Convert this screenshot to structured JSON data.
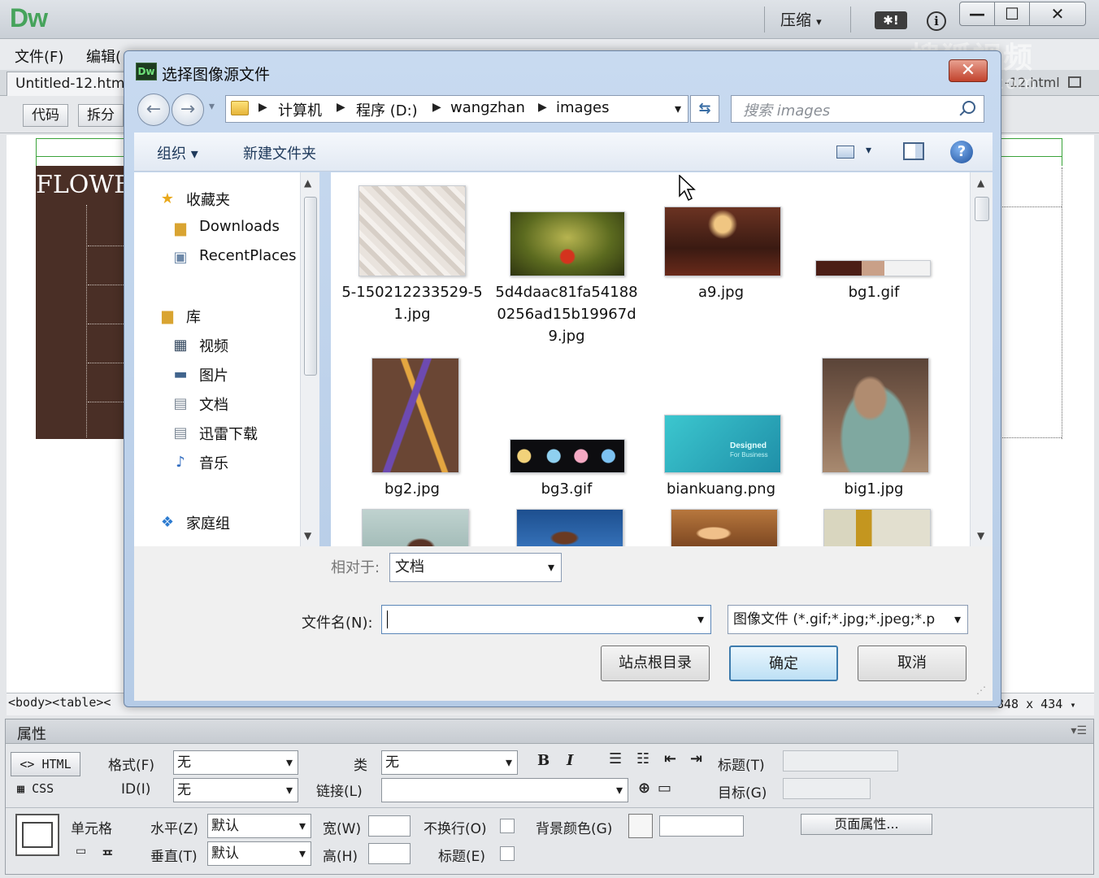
{
  "app": {
    "logo": "Dw",
    "compress_label": "压缩",
    "feedback_badge": "✱!",
    "info_label": "i",
    "min_label": "—",
    "max_label": "☐",
    "close_label": "✕"
  },
  "menu": {
    "file": "文件(F)",
    "edit": "编辑("
  },
  "doc_tabs": {
    "active": "Untitled-12.html",
    "right": "-12.html"
  },
  "doc_toolbar": {
    "code": "代码",
    "split": "拆分"
  },
  "design": {
    "page_text": "FLOWE"
  },
  "status": {
    "tags": "<body><table><",
    "size": "848 x 434"
  },
  "watermark": {
    "main": "搜狐视频",
    "sub": "tv.sohu.com"
  },
  "dialog": {
    "title": "选择图像源文件",
    "close_label": "✕",
    "address": {
      "crumbs": [
        "计算机",
        "程序 (D:)",
        "wangzhan",
        "images"
      ]
    },
    "search_placeholder": "搜索 images",
    "toolbar": {
      "organize": "组织 ▾",
      "new_folder": "新建文件夹"
    },
    "nav": {
      "favorites": "收藏夹",
      "downloads": "Downloads",
      "recent": "RecentPlaces",
      "library": "库",
      "video": "视频",
      "pictures": "图片",
      "documents": "文档",
      "xunlei": "迅雷下载",
      "music": "音乐",
      "homegroup": "家庭组"
    },
    "files": [
      {
        "name": "5-150212233529-51.jpg"
      },
      {
        "name": "5d4daac81fa541880256ad15b19967d9.jpg"
      },
      {
        "name": "a9.jpg"
      },
      {
        "name": "bg1.gif"
      },
      {
        "name": "bg2.jpg"
      },
      {
        "name": "bg3.gif"
      },
      {
        "name": "biankuang.png"
      },
      {
        "name": "big1.jpg"
      }
    ],
    "thumb_overlay": {
      "biankuang_line1": "Designed",
      "biankuang_line2": "For Business"
    },
    "relative_label": "相对于:",
    "relative_value": "文档",
    "filename_label": "文件名(N):",
    "filename_value": "",
    "filetype_value": "图像文件 (*.gif;*.jpg;*.jpeg;*.p",
    "site_root_btn": "站点根目录",
    "ok_btn": "确定",
    "cancel_btn": "取消"
  },
  "props": {
    "title": "属性",
    "html_btn": "HTML",
    "css_btn": "CSS",
    "format_label": "格式(F)",
    "format_value": "无",
    "class_label": "类",
    "class_value": "无",
    "id_label": "ID(I)",
    "id_value": "无",
    "link_label": "链接(L)",
    "bold": "B",
    "italic": "I",
    "heading_label": "标题(T)",
    "target_label": "目标(G)",
    "cell_label": "单元格",
    "horz_label": "水平(Z)",
    "horz_value": "默认",
    "vert_label": "垂直(T)",
    "vert_value": "默认",
    "width_label": "宽(W)",
    "height_label": "高(H)",
    "nowrap_label": "不换行(O)",
    "header_label": "标题(E)",
    "bgcolor_label": "背景颜色(G)",
    "page_props_btn": "页面属性...",
    "merge_label": "ᄑ"
  }
}
